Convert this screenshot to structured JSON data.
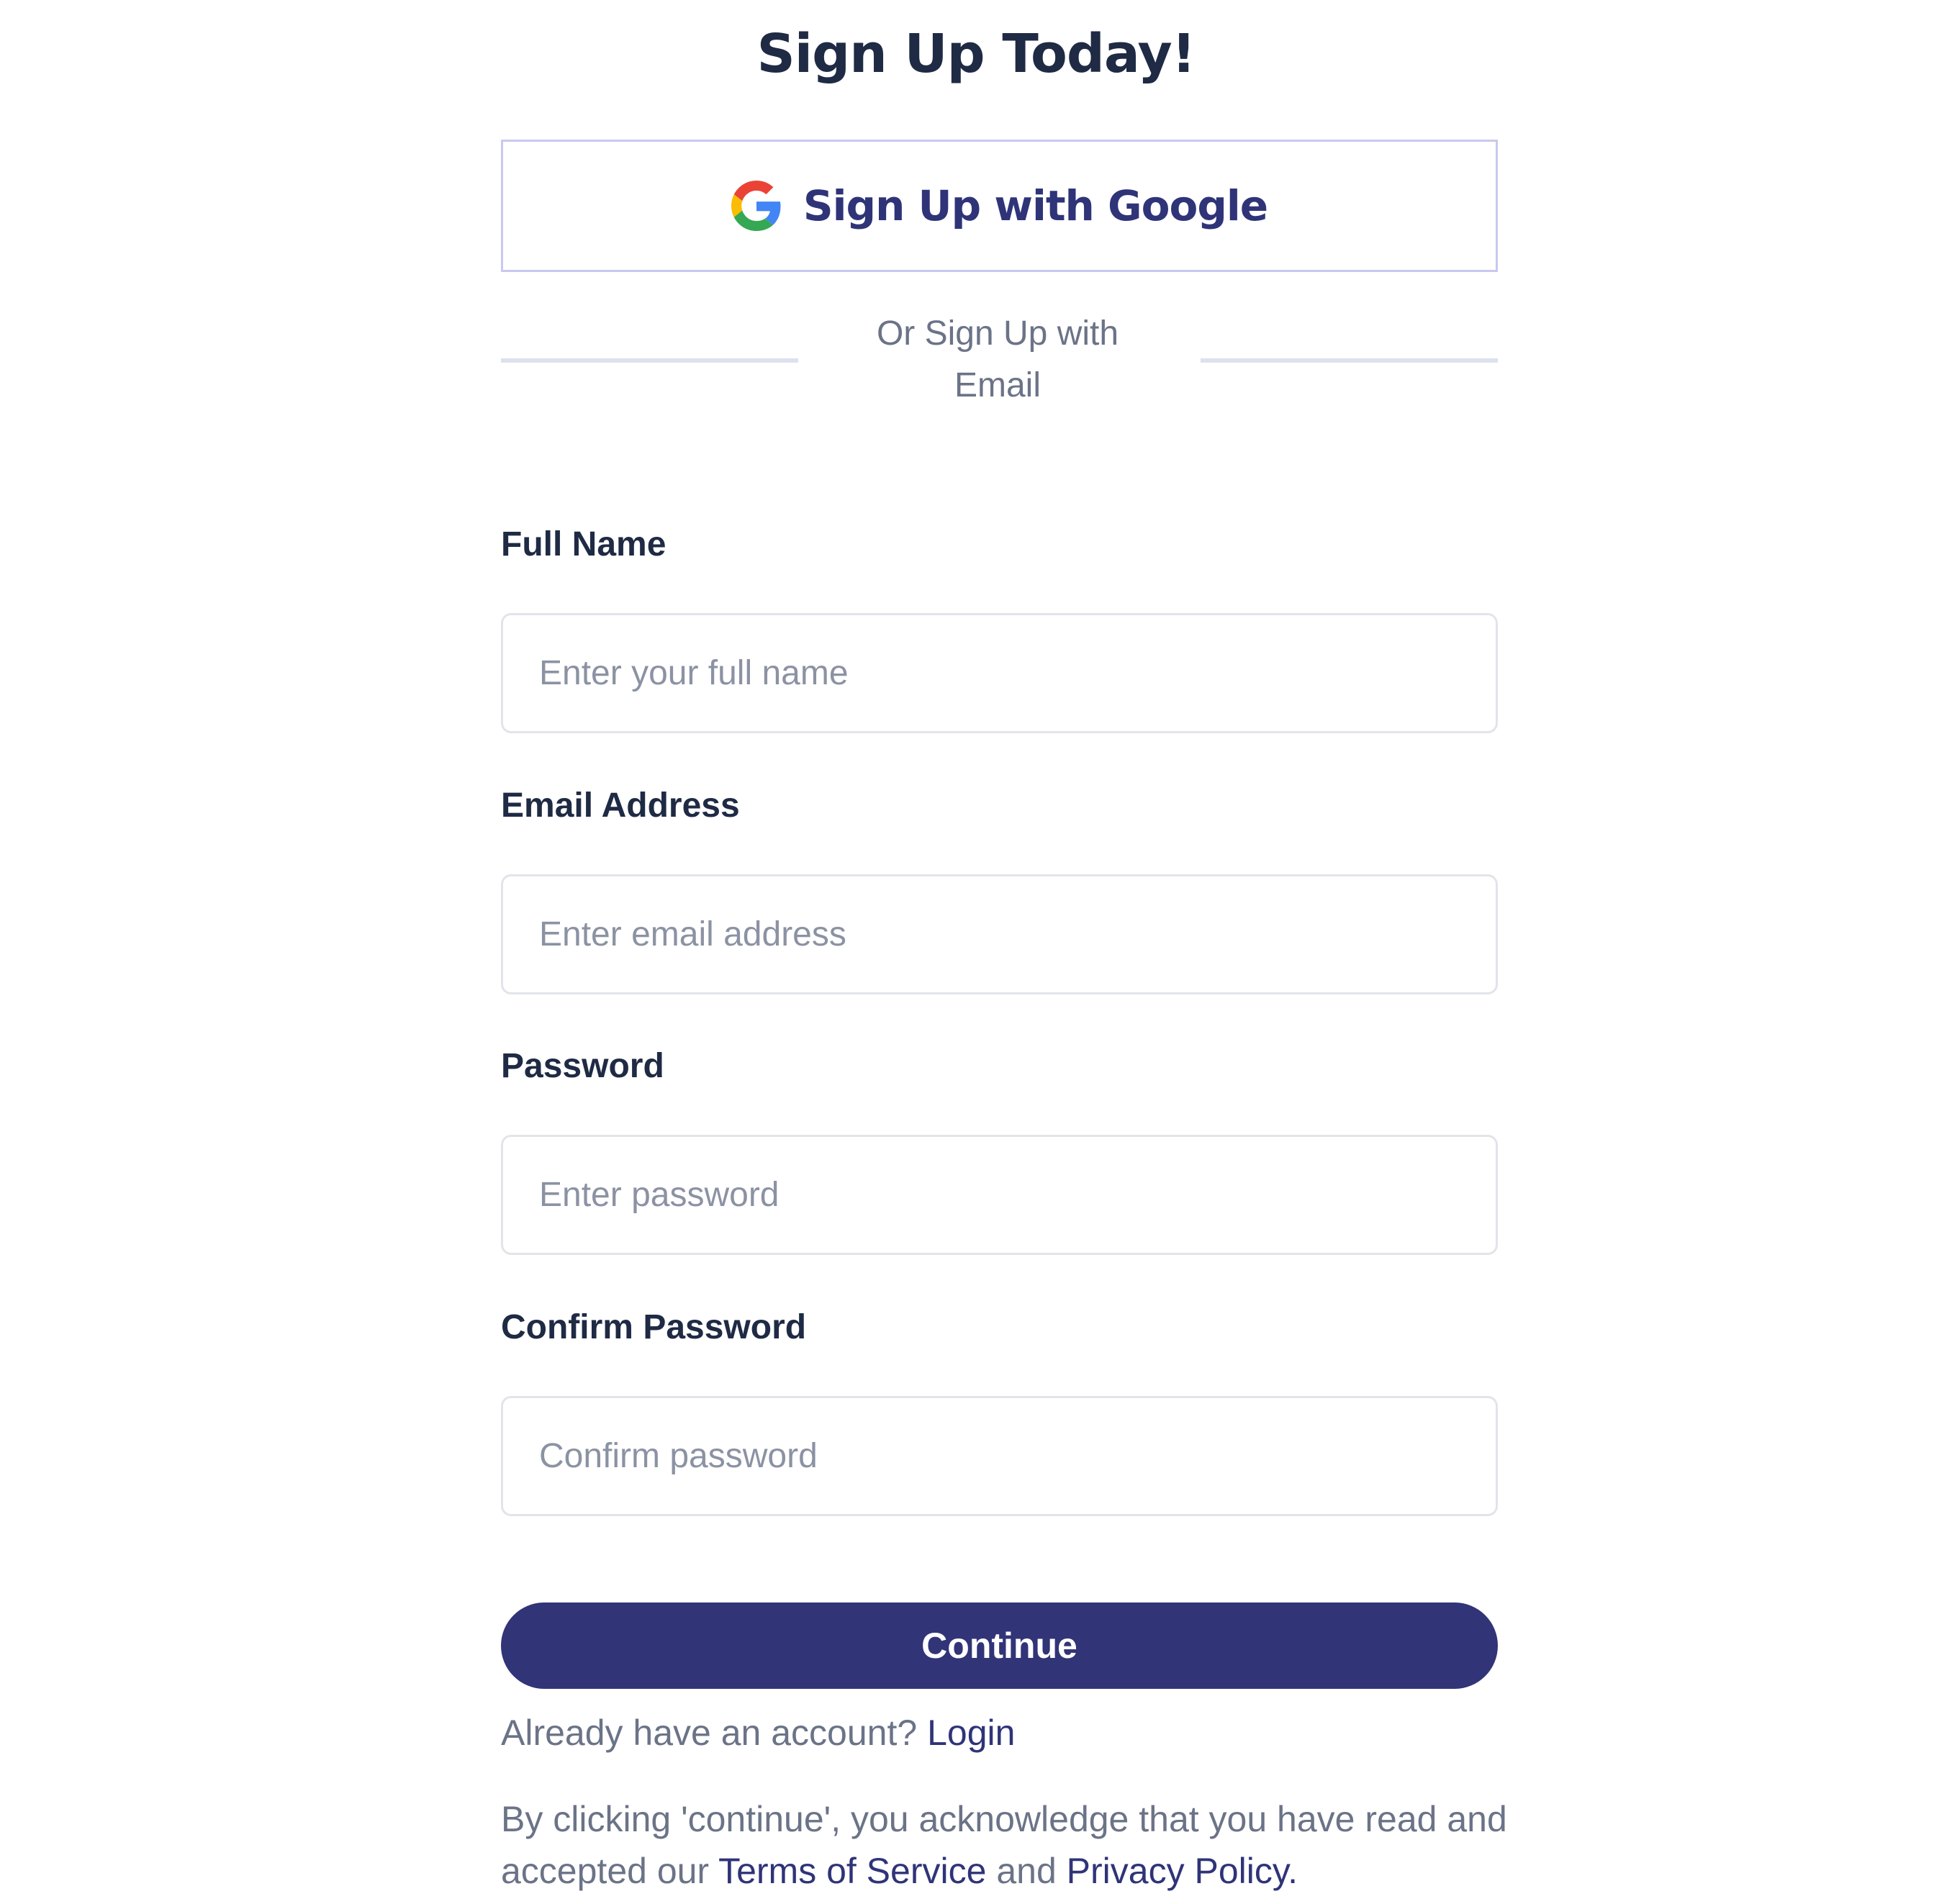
{
  "page": {
    "title": "Sign Up Today!"
  },
  "google_button": {
    "label": "Sign Up with Google",
    "icon": "google-icon"
  },
  "divider": {
    "text_line1": "Or Sign Up with",
    "text_line2": "Email"
  },
  "form": {
    "full_name": {
      "label": "Full Name",
      "placeholder": "Enter your full name",
      "value": ""
    },
    "email": {
      "label": "Email Address",
      "placeholder": "Enter email address",
      "value": ""
    },
    "password": {
      "label": "Password",
      "placeholder": "Enter password",
      "value": ""
    },
    "confirm_password": {
      "label": "Confirm Password",
      "placeholder": "Confirm password",
      "value": ""
    },
    "submit_label": "Continue"
  },
  "login": {
    "prompt": "Already have an account?",
    "link_label": "Login"
  },
  "legal": {
    "prefix": "By clicking 'continue', you acknowledge that you have read and accepted our",
    "terms_label": "Terms of Service",
    "conjunction": "and",
    "privacy_label": "Privacy Policy",
    "suffix": "."
  },
  "colors": {
    "primary": "#323478",
    "heading": "#1f2a44",
    "muted_text": "#6b7387",
    "placeholder": "#8b92a3",
    "google_border": "#c9c8f0",
    "input_border": "#e2e4ea",
    "divider": "#dde0ee"
  }
}
